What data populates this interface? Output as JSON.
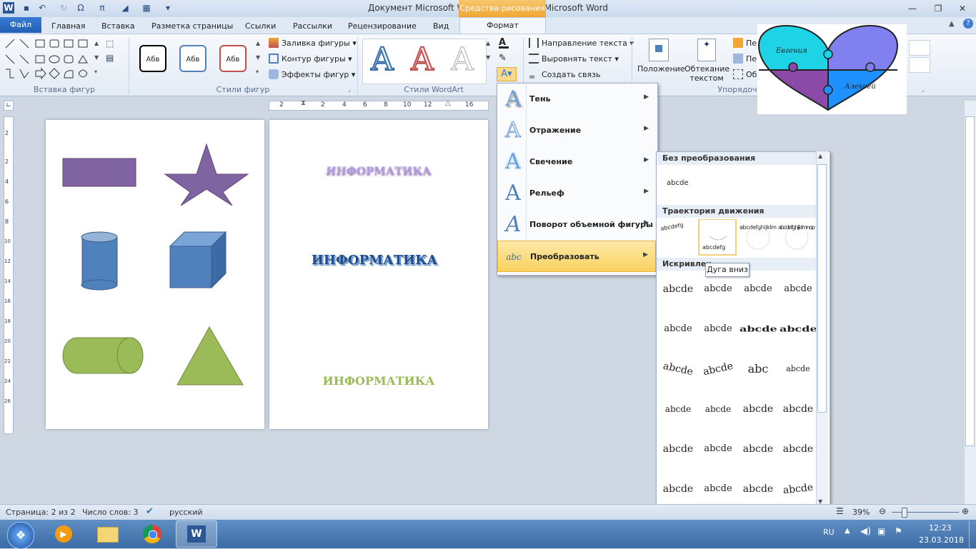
{
  "window": {
    "title": "Документ Microsoft Word 97-2003.doc  -  Microsoft Word",
    "context_tab_group": "Средства рисования"
  },
  "quick_access": {
    "app_icon": "word-icon",
    "save_icon": "save-icon",
    "undo_icon": "undo-icon",
    "redo_icon": "redo-icon",
    "symbol_label": "Ω",
    "equation_label": "π"
  },
  "tabs": [
    {
      "label": "Файл"
    },
    {
      "label": "Главная"
    },
    {
      "label": "Вставка"
    },
    {
      "label": "Разметка страницы"
    },
    {
      "label": "Ссылки"
    },
    {
      "label": "Рассылки"
    },
    {
      "label": "Рецензирование"
    },
    {
      "label": "Вид"
    },
    {
      "label": "Формат"
    }
  ],
  "ribbon": {
    "groups": {
      "insert_shapes": "Вставка фигур",
      "shape_styles": "Стили фигур",
      "wordart_styles": "Стили WordArt",
      "arrange": "Упорядоч"
    },
    "shape_style_samples": [
      "Абв",
      "Абв",
      "Абв"
    ],
    "shape_commands": [
      "Заливка фигуры",
      "Контур фигуры",
      "Эффекты фигур"
    ],
    "text_commands": [
      "Направление текста",
      "Выровнять текст",
      "Создать связь"
    ],
    "wordart_letter": "A",
    "position_label": "Положение",
    "wrap_label": "Обтекание",
    "wrap_label2": "текстом",
    "arrange_partial": [
      "Пер",
      "Пер",
      "Об"
    ]
  },
  "ruler": {
    "h_ticks": [
      "2",
      "2",
      "4",
      "6",
      "8",
      "10",
      "12",
      "16"
    ],
    "v_ticks": [
      "2",
      "2",
      "4",
      "6",
      "8",
      "10",
      "12",
      "14",
      "16",
      "18",
      "20",
      "22",
      "24",
      "26"
    ]
  },
  "page2": {
    "wordart": [
      "ИНФОРМАТИКА",
      "ИНФОРМАТИКА",
      "ИНФОРМАТИКА"
    ]
  },
  "effects_menu": {
    "items": [
      {
        "label": "Тень"
      },
      {
        "label": "Отражение"
      },
      {
        "label": "Свечение"
      },
      {
        "label": "Рельеф"
      },
      {
        "label": "Поворот объемной фигуры"
      },
      {
        "label": "Преобразовать"
      }
    ]
  },
  "transform_gallery": {
    "sections": [
      "Без преобразования",
      "Траектория движения",
      "Искривлен"
    ],
    "no_transform_sample": "abcde",
    "path_samples": [
      "abcdefg",
      "abcdefg",
      "abcdefghijklm",
      "abcdefghijklmnop"
    ],
    "tooltip": "Дуга вниз",
    "warp_sample": "abcde",
    "warp_circle_sample": "abc"
  },
  "heart": {
    "name1": "Евгения",
    "name2": "Алексей"
  },
  "status": {
    "page": "Страница: 2 из 2",
    "words": "Число слов: 3",
    "language": "русский",
    "zoom": "39%"
  },
  "tray": {
    "lang": "RU",
    "time": "12:23",
    "date": "23.03.2018"
  },
  "colors": {
    "purple": "#8064a2",
    "blue": "#4f81bd",
    "green": "#9bbb59",
    "accent": "#f0a734"
  }
}
